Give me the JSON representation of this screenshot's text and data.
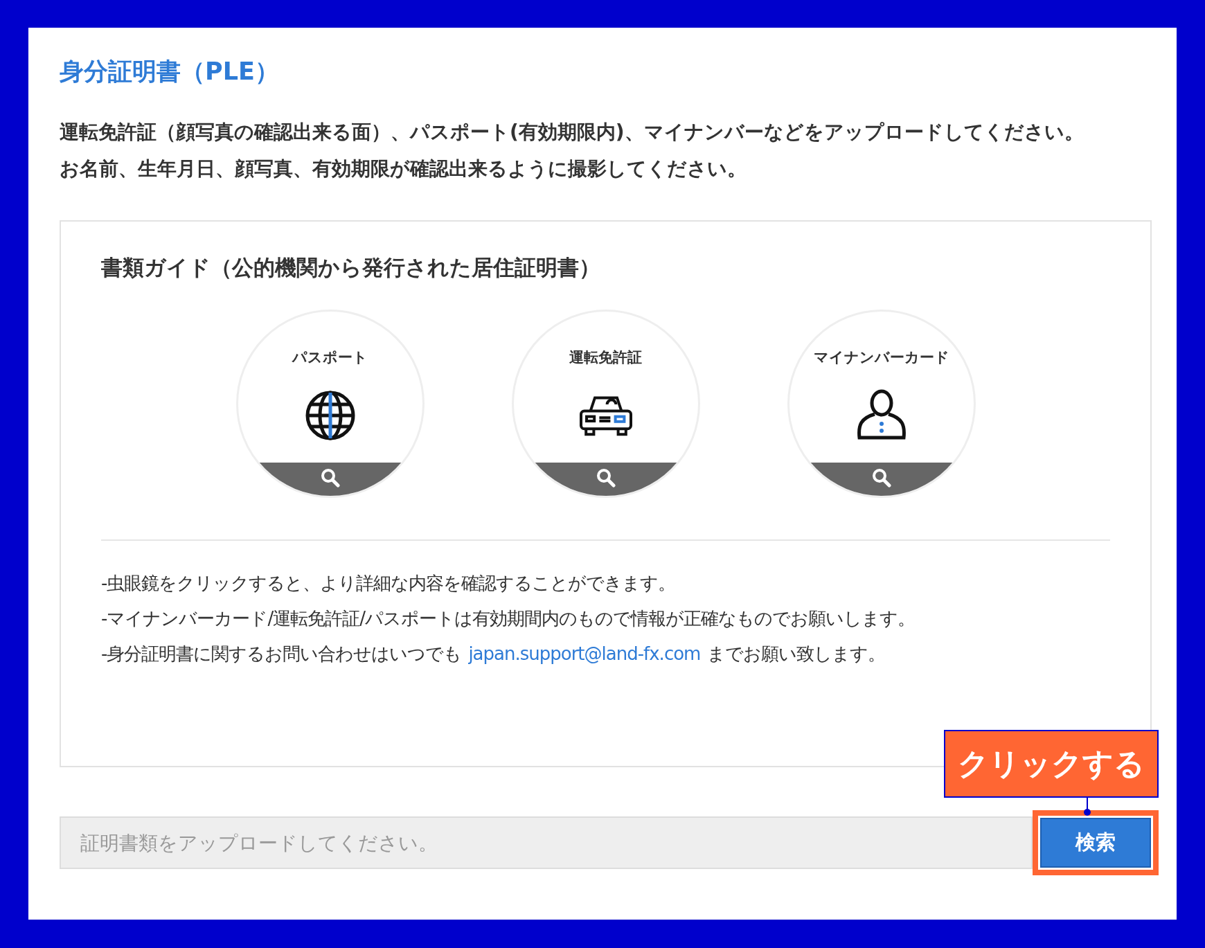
{
  "title": "身分証明書（PLE）",
  "instructions": [
    "運転免許証（顔写真の確認出来る面）、パスポート(有効期限内)、マイナンバーなどをアップロードしてください。",
    "お名前、生年月日、顔写真、有効期限が確認出来るように撮影してください。"
  ],
  "guide": {
    "heading": "書類ガイド（公的機関から発行された居住証明書）",
    "documents": [
      {
        "label": "パスポート",
        "kind": "globe"
      },
      {
        "label": "運転免許証",
        "kind": "car"
      },
      {
        "label": "マイナンバーカード",
        "kind": "person"
      }
    ],
    "notes": [
      {
        "text": "-虫眼鏡をクリックすると、より詳細な内容を確認することができます。"
      },
      {
        "text": "-マイナンバーカード/運転免許証/パスポートは有効期間内のもので情報が正確なものでお願いします。"
      },
      {
        "text": "-身分証明書に関するお問い合わせはいつでも",
        "link": "japan.support@land-fx.com",
        "after": "までお願い致します。"
      }
    ]
  },
  "upload": {
    "placeholder": "証明書類をアップロードしてください。",
    "button": "検索"
  },
  "callout": "クリックする"
}
